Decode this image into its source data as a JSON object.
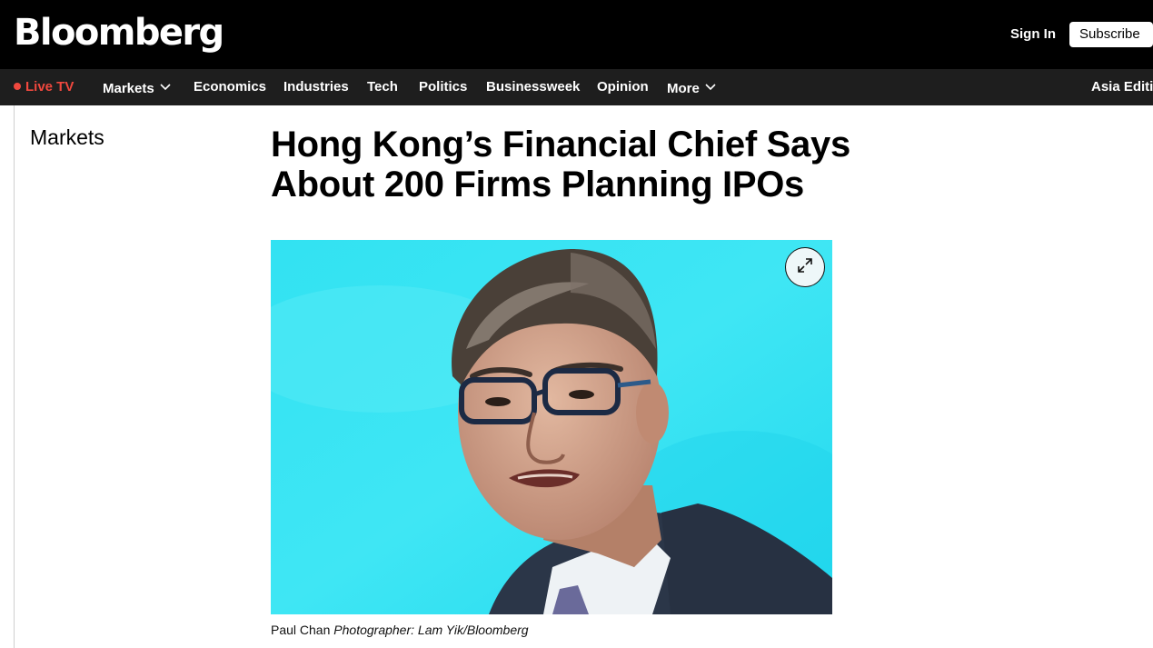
{
  "header": {
    "logo": "Bloomberg",
    "sign_in": "Sign In",
    "subscribe": "Subscribe"
  },
  "nav": {
    "live_tv": "Live TV",
    "items": [
      "Markets",
      "Economics",
      "Industries",
      "Tech",
      "Politics",
      "Businessweek",
      "Opinion",
      "More"
    ],
    "edition": "Asia Edition"
  },
  "article": {
    "section": "Markets",
    "headline_line1": "Hong Kong’s Financial Chief Says",
    "headline_line2": "About 200 Firms Planning IPOs",
    "caption_name": "Paul Chan",
    "caption_credit": "Photographer: Lam Yik/Bloomberg"
  },
  "icons": {
    "expand": "expand-icon",
    "chevron": "chevron-down-icon",
    "live": "live-dot-icon"
  },
  "colors": {
    "header_bg": "#000000",
    "nav_bg": "#1e1e1e",
    "live_red": "#f0483e",
    "photo_bg": "#2fe0f0"
  }
}
